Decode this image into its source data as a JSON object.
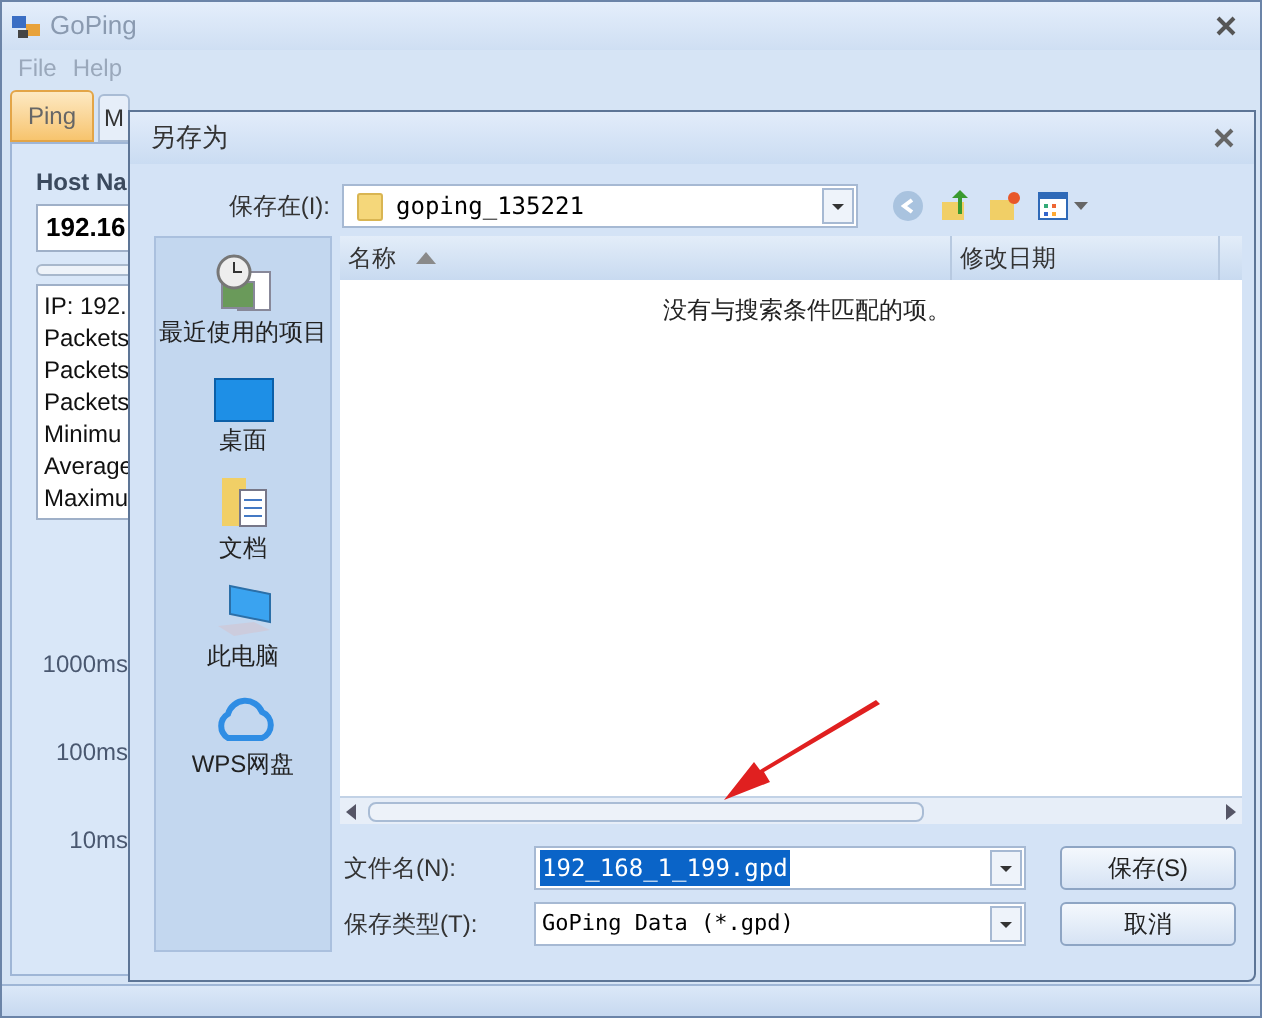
{
  "window": {
    "title": "GoPing"
  },
  "menu": [
    "File",
    "Help"
  ],
  "tabs": [
    {
      "label": "Ping",
      "selected": true
    },
    {
      "label": "M",
      "selected": false
    }
  ],
  "host": {
    "label": "Host Na",
    "value": "192.16"
  },
  "stats": [
    "IP: 192.",
    "Packets",
    "Packets",
    "Packets",
    "Minimu",
    "Average",
    "Maximu"
  ],
  "axis_labels": [
    "1000ms",
    "100ms",
    "10ms"
  ],
  "dialog": {
    "title": "另存为",
    "save_in": {
      "label": "保存在(I):",
      "value": "goping_135221"
    },
    "places": [
      {
        "label": "最近使用的项目",
        "kind": "recent"
      },
      {
        "label": "桌面",
        "kind": "desktop"
      },
      {
        "label": "文档",
        "kind": "documents"
      },
      {
        "label": "此电脑",
        "kind": "computer"
      },
      {
        "label": "WPS网盘",
        "kind": "cloud"
      }
    ],
    "columns": [
      {
        "label": "名称",
        "sorted": true
      },
      {
        "label": "修改日期",
        "sorted": false
      }
    ],
    "empty_message": "没有与搜索条件匹配的项。",
    "file_name": {
      "label": "文件名(N):",
      "value": "192_168_1_199.gpd"
    },
    "file_type": {
      "label": "保存类型(T):",
      "value": "GoPing Data (*.gpd)"
    },
    "buttons": [
      "保存(S)",
      "取消"
    ]
  }
}
